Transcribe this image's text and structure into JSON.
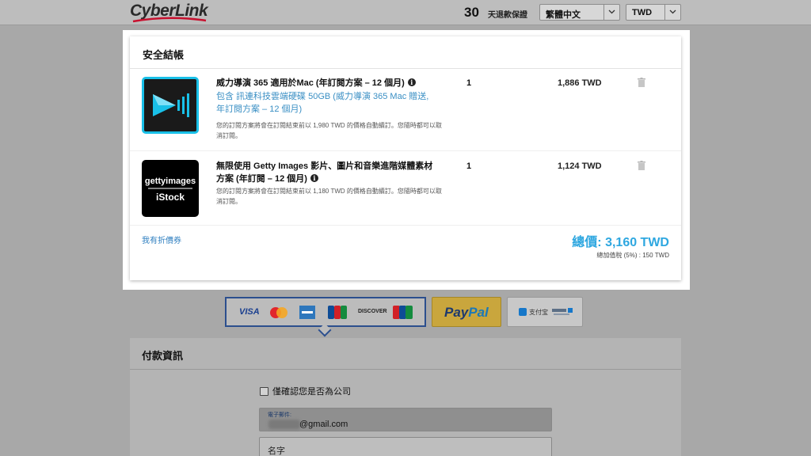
{
  "header": {
    "logo_text": "CyberLink",
    "guarantee_number": "30",
    "guarantee_text": "天退款保證",
    "language_select": "繁體中文",
    "currency_select": "TWD"
  },
  "checkout": {
    "title": "安全結帳",
    "items": [
      {
        "name": "威力導演 365 適用於Mac (年訂閱方案 – 12 個月)",
        "extra": "包含 訊連科技雲端硬碟 50GB (威力導演 365 Mac 贈送, 年訂閱方案 – 12 個月)",
        "note": "您的訂閱方案將會在訂閱結束前以 1,980 TWD 的價格自動續訂。您隨時都可以取消訂閱。",
        "quantity": "1",
        "price": "1,886 TWD"
      },
      {
        "name": "無限使用 Getty Images 影片、圖片和音樂進階媒體素材方案 (年訂閱 – 12 個月)",
        "image_text_top": "gettyimages",
        "image_text_bottom": "iStock",
        "note": "您的訂閱方案將會在訂閱結束前以 1,180 TWD 的價格自動續訂。您隨時都可以取消訂閱。",
        "quantity": "1",
        "price": "1,124 TWD"
      }
    ],
    "coupon_link": "我有折價券",
    "total": "總價: 3,160 TWD",
    "tax_note": "總加值稅 (5%) : 150 TWD"
  },
  "payment_methods": {
    "cards": [
      "VISA",
      "DISCOVER"
    ],
    "paypal": [
      "Pay",
      "Pal"
    ],
    "alipay": "支付宝"
  },
  "payment_info": {
    "title": "付款資訊",
    "company_checkbox_label": "僅確認您是否為公司",
    "email_label": "電子郵件:",
    "email_value": "@gmail.com",
    "name_placeholder": "名字"
  },
  "colors": {
    "accent": "#2ea7e0",
    "link": "#2f7fc0",
    "card_border": "#2c4f8e"
  }
}
